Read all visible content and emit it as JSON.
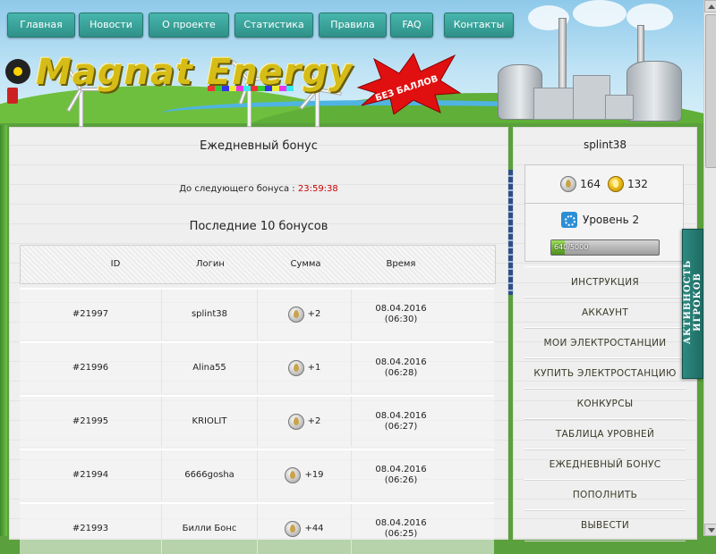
{
  "nav": {
    "items": [
      {
        "label": "Главная"
      },
      {
        "label": "Новости"
      },
      {
        "label": "О проекте"
      },
      {
        "label": "Статистика"
      },
      {
        "label": "Правила"
      },
      {
        "label": "FAQ"
      },
      {
        "label": "Контакты"
      }
    ]
  },
  "logo": {
    "text": "Magnat Energy",
    "badge": "БЕЗ БАЛЛОВ"
  },
  "main": {
    "title": "Ежедневный бонус",
    "next_bonus_label": "До следующего бонуса :",
    "next_bonus_timer": "23:59:38",
    "last_title": "Последние 10 бонусов",
    "columns": [
      "ID",
      "Логин",
      "Сумма",
      "Время"
    ],
    "rows": [
      {
        "id": "#21997",
        "login": "splint38",
        "amount": "+2",
        "date": "08.04.2016",
        "time": "(06:30)"
      },
      {
        "id": "#21996",
        "login": "Alina55",
        "amount": "+1",
        "date": "08.04.2016",
        "time": "(06:28)"
      },
      {
        "id": "#21995",
        "login": "KRIOLIT",
        "amount": "+2",
        "date": "08.04.2016",
        "time": "(06:27)"
      },
      {
        "id": "#21994",
        "login": "6666gosha",
        "amount": "+19",
        "date": "08.04.2016",
        "time": "(06:26)"
      },
      {
        "id": "#21993",
        "login": "Билли Бонс",
        "amount": "+44",
        "date": "08.04.2016",
        "time": "(06:25)"
      }
    ]
  },
  "sidebar": {
    "username": "splint38",
    "silver": "164",
    "gold": "132",
    "level_label": "Уровень 2",
    "xp_text": "640/5000",
    "xp_fraction": 0.128,
    "menu": [
      "ИНСТРУКЦИЯ",
      "АККАУНТ",
      "МОИ ЭЛЕКТРОСТАНЦИИ",
      "КУПИТЬ ЭЛЕКТРОСТАНЦИЮ",
      "КОНКУРСЫ",
      "ТАБЛИЦА УРОВНЕЙ",
      "ЕЖЕДНЕВНЫЙ БОНУС",
      "ПОПОЛНИТЬ",
      "ВЫВЕСТИ"
    ]
  },
  "activity_tab": "АКТИВНОСТЬ ИГРОКОВ",
  "colors": {
    "nav": "#3aa39a",
    "timer": "#cc0000",
    "logo": "#d6bc17"
  }
}
